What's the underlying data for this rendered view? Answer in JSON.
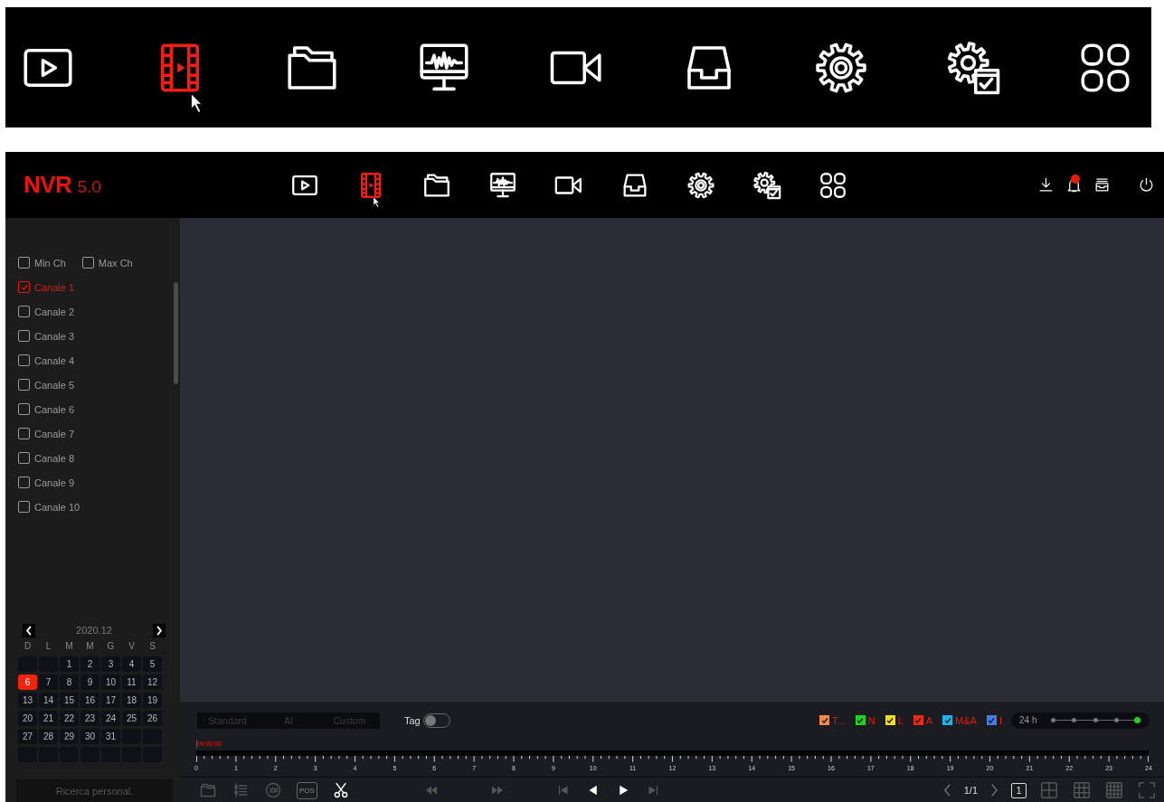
{
  "banner": {
    "icons": [
      {
        "kind": "play",
        "selected": false
      },
      {
        "kind": "film",
        "selected": true
      },
      {
        "kind": "folder",
        "selected": false
      },
      {
        "kind": "monitor",
        "selected": false
      },
      {
        "kind": "camera",
        "selected": false
      },
      {
        "kind": "tray",
        "selected": false
      },
      {
        "kind": "gear",
        "selected": false
      },
      {
        "kind": "gear-doc",
        "selected": false
      },
      {
        "kind": "apps",
        "selected": false
      }
    ]
  },
  "header": {
    "logo": "NVR",
    "version": "5.0",
    "nav": [
      {
        "kind": "play",
        "selected": false
      },
      {
        "kind": "film",
        "selected": true
      },
      {
        "kind": "folder",
        "selected": false
      },
      {
        "kind": "monitor",
        "selected": false
      },
      {
        "kind": "camera",
        "selected": false
      },
      {
        "kind": "tray",
        "selected": false
      },
      {
        "kind": "gear",
        "selected": false
      },
      {
        "kind": "gear-doc",
        "selected": false
      },
      {
        "kind": "apps",
        "selected": false
      }
    ],
    "tools": [
      {
        "kind": "download"
      },
      {
        "kind": "bell",
        "badge": true
      },
      {
        "kind": "archive"
      },
      {
        "kind": "power"
      }
    ]
  },
  "sidebar": {
    "filters": [
      {
        "label": "Min Ch",
        "checked": false
      },
      {
        "label": "Max Ch",
        "checked": false
      }
    ],
    "channels": [
      {
        "label": "Canale 1",
        "checked": true
      },
      {
        "label": "Canale 2",
        "checked": false
      },
      {
        "label": "Canale 3",
        "checked": false
      },
      {
        "label": "Canale 4",
        "checked": false
      },
      {
        "label": "Canale 5",
        "checked": false
      },
      {
        "label": "Canale 6",
        "checked": false
      },
      {
        "label": "Canale 7",
        "checked": false
      },
      {
        "label": "Canale 8",
        "checked": false
      },
      {
        "label": "Canale 9",
        "checked": false
      },
      {
        "label": "Canale 10",
        "checked": false
      }
    ],
    "calendar": {
      "month": "2020.12",
      "weekdays": [
        "D",
        "L",
        "M",
        "M",
        "G",
        "V",
        "S"
      ],
      "cells": [
        {
          "kind": "blank"
        },
        {
          "kind": "blank"
        },
        {
          "kind": "day",
          "day": "1",
          "selected": false
        },
        {
          "kind": "day",
          "day": "2",
          "selected": false
        },
        {
          "kind": "day",
          "day": "3",
          "selected": false
        },
        {
          "kind": "day",
          "day": "4",
          "selected": false
        },
        {
          "kind": "day",
          "day": "5",
          "selected": false
        },
        {
          "kind": "day",
          "day": "6",
          "selected": true
        },
        {
          "kind": "day",
          "day": "7",
          "selected": false
        },
        {
          "kind": "day",
          "day": "8",
          "selected": false
        },
        {
          "kind": "day",
          "day": "9",
          "selected": false
        },
        {
          "kind": "day",
          "day": "10",
          "selected": false
        },
        {
          "kind": "day",
          "day": "11",
          "selected": false
        },
        {
          "kind": "day",
          "day": "12",
          "selected": false
        },
        {
          "kind": "day",
          "day": "13",
          "selected": false
        },
        {
          "kind": "day",
          "day": "14",
          "selected": false
        },
        {
          "kind": "day",
          "day": "15",
          "selected": false
        },
        {
          "kind": "day",
          "day": "16",
          "selected": false
        },
        {
          "kind": "day",
          "day": "17",
          "selected": false
        },
        {
          "kind": "day",
          "day": "18",
          "selected": false
        },
        {
          "kind": "day",
          "day": "19",
          "selected": false
        },
        {
          "kind": "day",
          "day": "20",
          "selected": false
        },
        {
          "kind": "day",
          "day": "21",
          "selected": false
        },
        {
          "kind": "day",
          "day": "22",
          "selected": false
        },
        {
          "kind": "day",
          "day": "23",
          "selected": false
        },
        {
          "kind": "day",
          "day": "24",
          "selected": false
        },
        {
          "kind": "day",
          "day": "25",
          "selected": false
        },
        {
          "kind": "day",
          "day": "26",
          "selected": false
        },
        {
          "kind": "day",
          "day": "27",
          "selected": false
        },
        {
          "kind": "day",
          "day": "28",
          "selected": false
        },
        {
          "kind": "day",
          "day": "29",
          "selected": false
        },
        {
          "kind": "day",
          "day": "30",
          "selected": false
        },
        {
          "kind": "day",
          "day": "31",
          "selected": false
        },
        {
          "kind": "blank"
        },
        {
          "kind": "blank"
        },
        {
          "kind": "blank"
        },
        {
          "kind": "blank"
        },
        {
          "kind": "blank"
        },
        {
          "kind": "blank"
        },
        {
          "kind": "blank"
        },
        {
          "kind": "blank"
        },
        {
          "kind": "blank"
        }
      ]
    },
    "search_button": "Ricerca personal."
  },
  "playback": {
    "modes": [
      {
        "label": "Standard",
        "selected": false
      },
      {
        "label": "AI",
        "selected": false
      },
      {
        "label": "Custom",
        "selected": false
      }
    ],
    "tag": {
      "label": "Tag",
      "on": false
    },
    "legend": [
      {
        "label": "T...",
        "color": "#f08a4b",
        "checked": true
      },
      {
        "label": "N",
        "color": "#1ed41e",
        "checked": true
      },
      {
        "label": "L",
        "color": "#f2dc12",
        "checked": true
      },
      {
        "label": "A",
        "color": "#ee2a12",
        "checked": true
      },
      {
        "label": "M&A",
        "color": "#1eb6e8",
        "checked": true
      },
      {
        "label": "I",
        "color": "#3f7cf0",
        "checked": true
      }
    ],
    "zoom": {
      "label": "24 h",
      "level": 1
    },
    "timeline": {
      "time": "00:00:00",
      "hours": [
        "0",
        "1",
        "2",
        "3",
        "4",
        "5",
        "6",
        "7",
        "8",
        "9",
        "10",
        "11",
        "12",
        "13",
        "14",
        "15",
        "16",
        "17",
        "18",
        "19",
        "20",
        "21",
        "22",
        "23",
        "24"
      ]
    },
    "tools": [
      {
        "kind": "folder",
        "disabled": true
      },
      {
        "kind": "list",
        "disabled": true
      },
      {
        "kind": "clip",
        "disabled": true
      },
      {
        "kind": "pos",
        "label": "POS",
        "disabled": true
      },
      {
        "kind": "scissors",
        "disabled": false
      }
    ],
    "controls": [
      {
        "kind": "rewind",
        "disabled": true
      },
      {
        "kind": "forward",
        "disabled": true
      },
      {
        "kind": "first",
        "disabled": true
      },
      {
        "kind": "back",
        "disabled": false
      },
      {
        "kind": "play",
        "disabled": false
      },
      {
        "kind": "last",
        "disabled": true
      }
    ],
    "page": "1/1",
    "layouts": [
      {
        "kind": "single",
        "label": "1",
        "selected": true
      },
      {
        "kind": "quad",
        "selected": false
      },
      {
        "kind": "nine",
        "selected": false
      },
      {
        "kind": "sixteen",
        "selected": false
      },
      {
        "kind": "fullscreen",
        "selected": false
      }
    ]
  }
}
